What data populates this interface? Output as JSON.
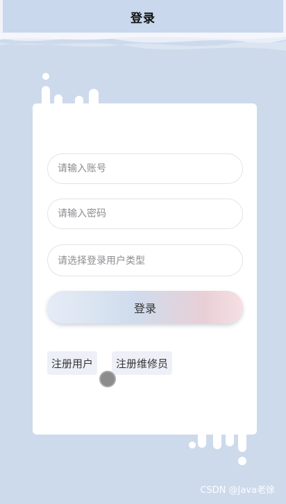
{
  "header": {
    "title": "登录"
  },
  "form": {
    "account_placeholder": "请输入账号",
    "password_placeholder": "请输入密码",
    "user_type_placeholder": "请选择登录用户类型",
    "login_label": "登录"
  },
  "links": {
    "register_user": "注册用户",
    "register_repairman": "注册维修员"
  },
  "watermark": "CSDN @Java老徐",
  "colors": {
    "background": "#cddaec",
    "card": "#ffffff",
    "drip": "#ffffff"
  }
}
